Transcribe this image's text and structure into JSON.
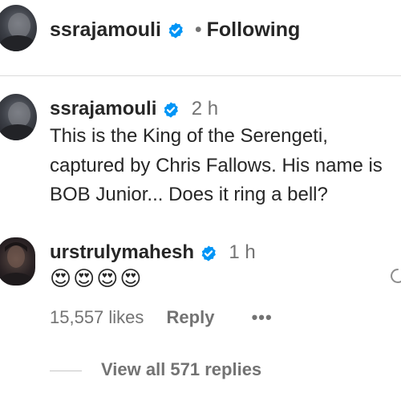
{
  "header": {
    "username": "ssrajamouli",
    "separator": "•",
    "follow_status": "Following"
  },
  "post": {
    "username": "ssrajamouli",
    "time": "2 h",
    "caption_lines": [
      "This is the King of the Serengeti,",
      "captured by Chris Fallows. His name is",
      "BOB Junior... Does it ring a bell?"
    ]
  },
  "comment": {
    "username": "urstrulymahesh",
    "time": "1 h",
    "text": "😍😍😍😍",
    "likes": "15,557 likes",
    "reply_label": "Reply",
    "more_label": "•••",
    "view_replies": "View all 571 replies"
  },
  "colors": {
    "verified_blue": "#0095f6",
    "primary_text": "#262626",
    "secondary_text": "#737373",
    "divider": "#dbdbdb"
  },
  "icons": [
    "verified-icon",
    "reply-icon",
    "more-options-icon"
  ]
}
